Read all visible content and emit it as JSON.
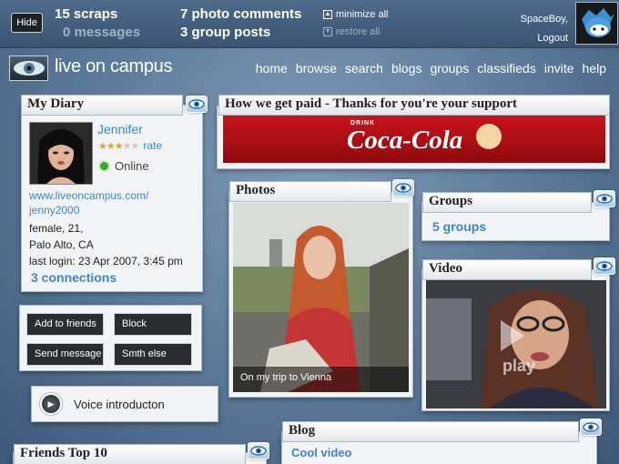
{
  "topbar": {
    "hide_label": "Hide",
    "scraps": "15 scraps",
    "messages": "0 messages",
    "photo_comments": "7 photo comments",
    "group_posts": "3 group posts",
    "minimize_all": "minimize all",
    "restore_all": "restore all",
    "username": "SpaceBoy,",
    "logout": "Logout"
  },
  "brand": {
    "name": "live on campus"
  },
  "nav": [
    "home",
    "browse",
    "search",
    "blogs",
    "groups",
    "classifieds",
    "invite",
    "help"
  ],
  "diary": {
    "title": "My Diary",
    "name": "Jennifer",
    "rating_stars": 3,
    "rating_max": 5,
    "rate_label": "rate",
    "status": "Online",
    "url_line1": "www.liveoncampus.com/",
    "url_line2": "jenny2000",
    "info1": "female, 21,",
    "info2": "Palo Alto, CA",
    "last_login": "last login: 23 Apr 2007, 3:45 pm",
    "connections": "3 connections"
  },
  "actions": {
    "add_friends": "Add to friends",
    "block": "Block",
    "send_message": "Send message",
    "smth_else": "Smth else"
  },
  "voice": {
    "label": "Voice introducton"
  },
  "friends": {
    "title": "Friends Top 10"
  },
  "ad": {
    "title": "How we get paid - Thanks for you're your support",
    "brand_top": "DRINK",
    "brand": "Coca-Cola"
  },
  "photos": {
    "title": "Photos",
    "caption": "On my trip to Vienna"
  },
  "groups": {
    "title": "Groups",
    "count": "5 groups"
  },
  "video": {
    "title": "Video",
    "play_label": "play"
  },
  "blog": {
    "title": "Blog",
    "post_title": "Cool video"
  },
  "colors": {
    "link": "#3b86d1",
    "star": "#e4a21e",
    "online": "#3aa534"
  }
}
